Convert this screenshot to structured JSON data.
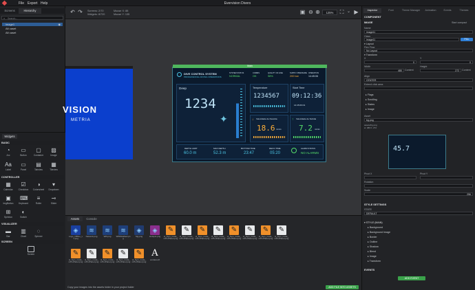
{
  "app": {
    "title": "Evervision Divers",
    "menu": [
      "File",
      "Export",
      "Help"
    ]
  },
  "left": {
    "tabs": [
      "Screens",
      "Hierarchy"
    ],
    "search_placeholder": "Search...",
    "tree": [
      "image1",
      "Alt caset",
      "Alt caset"
    ],
    "widgets_title": "Widgets",
    "sections": {
      "basic": "BASIC",
      "controller": "CONTROLLER",
      "visualizer": "VISUALIZER",
      "screen": "SCREEN"
    },
    "basic": [
      "Arc",
      "Button",
      "Container",
      "Image",
      "Label",
      "Panel",
      "Tabview",
      "Tileview"
    ],
    "controller": [
      "Calendar",
      "Checkbox",
      "Colorwheel",
      "Dropdown",
      "ImgButton",
      "Keyboard",
      "Roller",
      "Slider",
      "Spinbox",
      "Switch"
    ],
    "visualizer": [
      "Bar",
      "Chart",
      "Spinner"
    ],
    "screen": [
      "Screen"
    ]
  },
  "toolbar": {
    "stats": [
      "Screens: 2/70",
      "Widgets: 8/720",
      "Mouse X: 88",
      "Mouse Y: 135"
    ],
    "zoom": "125%"
  },
  "canvas": {
    "blue_text1": "VISION",
    "blue_text2": "METRIA",
    "device_title": "Main",
    "dive_title": "DIVE CONTROL SYSTEM",
    "dive_sub": "PROFESSIONAL DIVING OPERATIONS",
    "system": "SYSTEM STATUS",
    "system_val": "NORMAL",
    "comms": "COMMS",
    "comms_val": "OK",
    "quality": "QUALITY OF LINE",
    "quality_val": "98%",
    "supply": "SUPPLY PRESSURE",
    "supply_val": "200 bar",
    "operation": "OPERATION",
    "operation_val": "14:45:06",
    "deep": "Deep",
    "deep_val": "1234",
    "temp": "Temperature",
    "temp_val": "1234567",
    "start": "Start Time",
    "start_val": "09:12:36",
    "start_sub": "14:45:06 D1",
    "desc": "Velocidade de Descida",
    "desc_val": "18.6",
    "desc_unit": "m/min",
    "asc": "Velocidade de Subida",
    "asc_val": "7.2",
    "asc_unit": "m/min",
    "bottom": [
      {
        "l": "DEPTH LIMIT",
        "v": "60.0 m"
      },
      {
        "l": "MAX DEPTH",
        "v": "52.3 m"
      },
      {
        "l": "BOTTOM TIME",
        "v": "23:47"
      },
      {
        "l": "DECO TIME",
        "v": "05:20"
      }
    ],
    "alarm": "ALARM STATUS",
    "alarm_val": "NO ALARMS"
  },
  "assets": {
    "tabs": [
      "Assets",
      "Console"
    ],
    "items": [
      "Logo_Offline_v1.png",
      "Network.png",
      "Wifi.png",
      "WifiDisabled.png",
      "Sig.png",
      "Hotspot.png",
      "ui_Sym_Code_mPorPanel.png",
      "ui_Sym_Code_mPorPanel.png",
      "ui_Sym_Code_mPorPanel.png",
      "ui_Sym_Code_mPorPanel.png",
      "ui_Sym_Code_mPorPanel.png",
      "ui_Sym_Code_mPorPanel.png",
      "ui_Sym_Code_mPorPanel.png",
      "ui_Sym_Code_mPorPanel.png",
      "ui_Sym_Code_mPorPanel.png",
      "ui_Sym_Code_mPorPanel.png",
      "ui_Sym_Code_mPorPanel.png",
      "ui_Sym_Code_mPorPanel.png",
      "ui_Sym_Code_mPorPanel.png",
      "verdana.ttf"
    ],
    "footer": "Copy your images into the assets folder in your project folder",
    "add_btn": "ADD FILE INTO ASSETS"
  },
  "right": {
    "tabs": [
      "Inspector",
      "Font",
      "Theme Manager",
      "Animation",
      "Events",
      "Themes"
    ],
    "component": "COMPONENT",
    "image": "IMAGE",
    "start_compact": "Start compact",
    "name_label": "Name",
    "name_val": "image11",
    "class_label": "Class",
    "class_val": "image11",
    "fill_btn": "FILL",
    "layout": "Layout",
    "flex_label": "Flex Flow",
    "flex_val": "No Layout",
    "transform": "Transform",
    "x_label": "X",
    "x_val": "0",
    "y_label": "Y",
    "y_val": "0",
    "w_label": "Width",
    "w_val": "480",
    "w_unit": "Content",
    "h_label": "Height",
    "h_val": "272",
    "h_unit": "Content",
    "align_label": "Align",
    "align_val": "CENTER",
    "extend": "Extend click area",
    "groups": [
      "Flags",
      "Scrolling",
      "States",
      "Image"
    ],
    "asset_label": "Asset",
    "asset_val": "bg.png",
    "note": "assets/bg.png\nw: 480 h: 272",
    "pivot_x": "Pivot X",
    "pivot_y": "Pivot Y",
    "rotation": "Rotation",
    "scale": "Scale",
    "scale_val": "256",
    "style": "STYLE SETTINGS",
    "state_label": "STATE",
    "state_val": "DEFAULT",
    "style_main": "STYLE (MAIN)",
    "style_items": [
      "Background",
      "Background Image",
      "Border",
      "Outline",
      "Shadow",
      "Blend",
      "Image",
      "Transform"
    ],
    "events": "EVENTS",
    "add_event": "ADD EVENT"
  }
}
